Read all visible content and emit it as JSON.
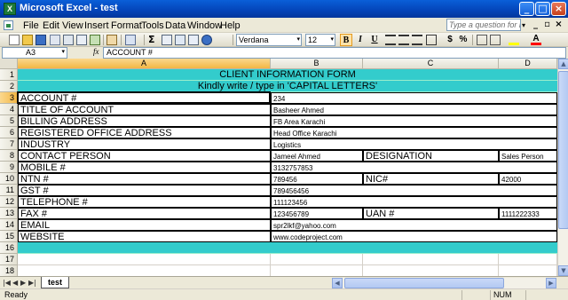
{
  "window": {
    "title": "Microsoft Excel - test",
    "app_icon_glyph": "X",
    "minimize_glyph": "_",
    "maximize_glyph": "□",
    "close_glyph": "×"
  },
  "menu": {
    "items": [
      "File",
      "Edit",
      "View",
      "Insert",
      "Format",
      "Tools",
      "Data",
      "Window",
      "Help"
    ],
    "help_placeholder": "Type a question for help",
    "help_arrow": "▾",
    "doc_min": "_",
    "doc_restore": "▫",
    "doc_close": "×"
  },
  "toolbar": {
    "font_name": "Verdana",
    "font_size": "12",
    "bold_label": "B",
    "italic_label": "I",
    "underline_label": "U",
    "bold_active": true,
    "currency_label": "$",
    "percent_label": "%",
    "sum_label": "Σ",
    "dropdown_arrow": "▾"
  },
  "formula_bar": {
    "name_box": "A3",
    "fx_label": "fx",
    "formula": "ACCOUNT #"
  },
  "sheet": {
    "columns": [
      "A",
      "B",
      "C",
      "D"
    ],
    "rows": [
      "1",
      "2",
      "3",
      "4",
      "5",
      "6",
      "7",
      "8",
      "9",
      "10",
      "11",
      "12",
      "13",
      "14",
      "15",
      "16",
      "17",
      "18"
    ],
    "header_fill": "#33cccc",
    "title": "CLIENT INFORMATION FORM",
    "subtitle": "Kindly write / type in 'CAPITAL LETTERS'",
    "fields": [
      {
        "label": "ACCOUNT #",
        "value": "234"
      },
      {
        "label": "TITLE OF ACCOUNT",
        "value": "Basheer Ahmed"
      },
      {
        "label": "BILLING ADDRESS",
        "value": "FB Area Karachi"
      },
      {
        "label": "REGISTERED OFFICE ADDRESS",
        "value": "Head Office Karachi"
      },
      {
        "label": "INDUSTRY",
        "value": "Logistics"
      },
      {
        "label": "CONTACT PERSON",
        "value": "Jameel Ahmed",
        "c_label": "DESIGNATION",
        "d_value": "Sales Person"
      },
      {
        "label": "MOBILE #",
        "value": "3132757853"
      },
      {
        "label": "NTN #",
        "value": "789456",
        "c_label": "NIC#",
        "d_value": "42000"
      },
      {
        "label": "GST #",
        "value": "789456456"
      },
      {
        "label": "TELEPHONE #",
        "value": "111123456"
      },
      {
        "label": "FAX #",
        "value": "123456789",
        "c_label": "UAN #",
        "d_value": "1111222333"
      },
      {
        "label": "EMAIL",
        "value": "spr2lkf@yahoo.com"
      },
      {
        "label": "WEBSITE",
        "value": "www.codeproject.com"
      }
    ]
  },
  "tabs": {
    "nav": [
      "|◀",
      "◀",
      "▶",
      "▶|"
    ],
    "active": "test"
  },
  "status": {
    "text": "Ready",
    "num": "NUM"
  },
  "scroll": {
    "up": "▲",
    "down": "▼",
    "left": "◀",
    "right": "▶"
  }
}
